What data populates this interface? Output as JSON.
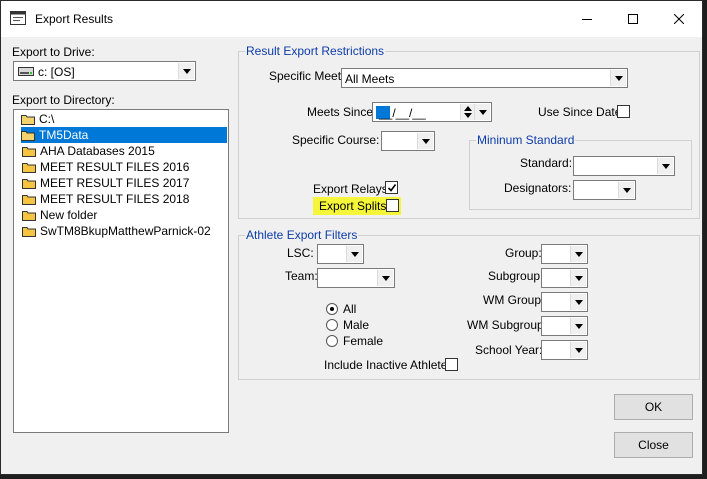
{
  "window": {
    "title": "Export Results",
    "controls": {
      "minimize": "minimize",
      "maximize": "maximize",
      "close": "close"
    }
  },
  "drive": {
    "label": "Export to Drive:",
    "value": "c: [OS]"
  },
  "directory": {
    "label": "Export to Directory:",
    "items": [
      "C:\\",
      "TM5Data",
      "AHA Databases 2015",
      "MEET RESULT FILES 2016",
      "MEET RESULT FILES 2017",
      "MEET RESULT FILES 2018",
      "New folder",
      "SwTM8BkupMatthewParnick-02"
    ],
    "selected": "TM5Data"
  },
  "restrictions": {
    "title": "Result Export Restrictions",
    "specific_meet_label": "Specific Meet:",
    "specific_meet_value": "All Meets",
    "meets_since_label": "Meets Since:",
    "meets_since_value": "__/__/__",
    "use_since_date_label": "Use Since Date",
    "use_since_date_checked": false,
    "specific_course_label": "Specific Course:",
    "specific_course_value": "",
    "export_relays_label": "Export Relays",
    "export_relays_checked": true,
    "export_splits_label": "Export Splits",
    "export_splits_checked": false,
    "highlight_color": "#f5f53a"
  },
  "min_standard": {
    "title": "Mininum Standard",
    "standard_label": "Standard:",
    "standard_value": "",
    "designators_label": "Designators:",
    "designators_value": ""
  },
  "athlete_filters": {
    "title": "Athlete Export Filters",
    "lsc_label": "LSC:",
    "team_label": "Team:",
    "gender_options": [
      "All",
      "Male",
      "Female"
    ],
    "gender_selected": "All",
    "include_inactive_label": "Include Inactive Athletes",
    "include_inactive_checked": false,
    "group_label": "Group:",
    "subgroup_label": "Subgroup:",
    "wm_group_label": "WM Group:",
    "wm_subgroup_label": "WM Subgroup:",
    "school_year_label": "School Year:"
  },
  "buttons": {
    "ok": "OK",
    "close": "Close"
  },
  "colors": {
    "group_title": "#0d3ca8",
    "selection": "#0078d7"
  }
}
